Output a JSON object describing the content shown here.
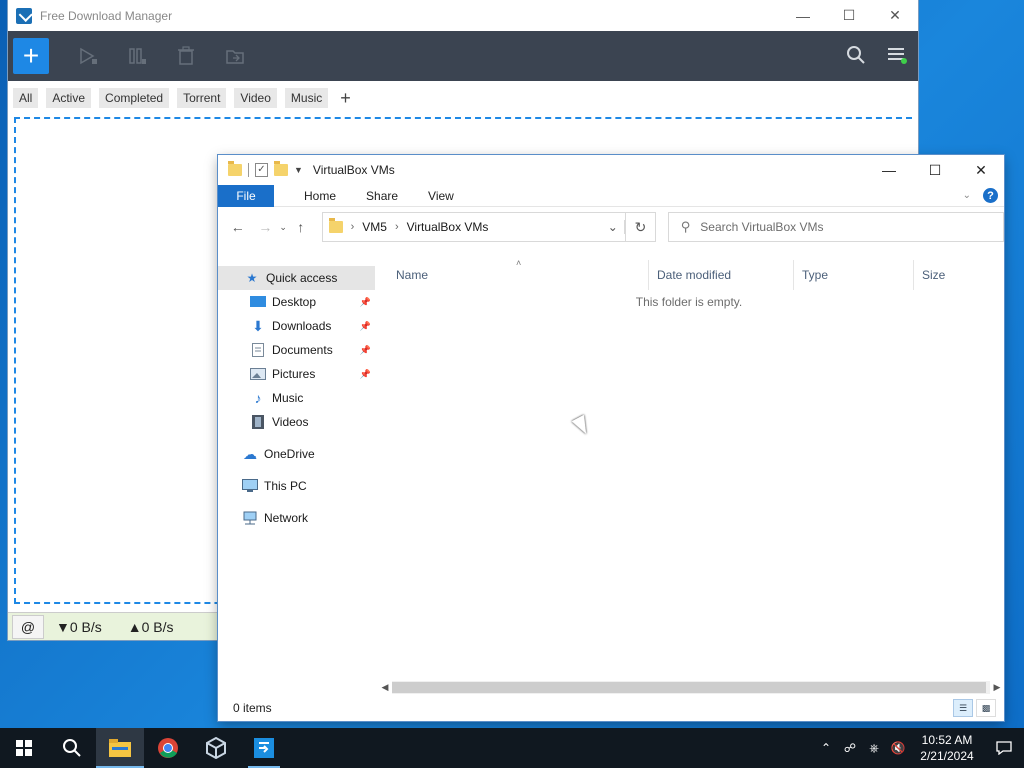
{
  "fdm": {
    "title": "Free Download Manager",
    "filters": [
      "All",
      "Active",
      "Completed",
      "Torrent",
      "Video",
      "Music"
    ],
    "add_filter": "+",
    "download_speed": "▼0 B/s",
    "upload_speed": "▲0 B/s"
  },
  "explorer": {
    "title": "VirtualBox VMs",
    "ribbon": {
      "file": "File",
      "home": "Home",
      "share": "Share",
      "view": "View"
    },
    "address": {
      "crumb1": "VM5",
      "crumb2": "VirtualBox VMs"
    },
    "search_placeholder": "Search VirtualBox VMs",
    "nav": {
      "quick_access": "Quick access",
      "desktop": "Desktop",
      "downloads": "Downloads",
      "documents": "Documents",
      "pictures": "Pictures",
      "music": "Music",
      "videos": "Videos",
      "onedrive": "OneDrive",
      "this_pc": "This PC",
      "network": "Network"
    },
    "columns": {
      "name": "Name",
      "date": "Date modified",
      "type": "Type",
      "size": "Size"
    },
    "empty_message": "This folder is empty.",
    "status": "0 items"
  },
  "taskbar": {
    "time": "10:52 AM",
    "date": "2/21/2024"
  },
  "colors": {
    "accent": "#1a6fc9",
    "fdm_toolbar": "#3b4451",
    "fdm_add": "#1e88e5"
  }
}
